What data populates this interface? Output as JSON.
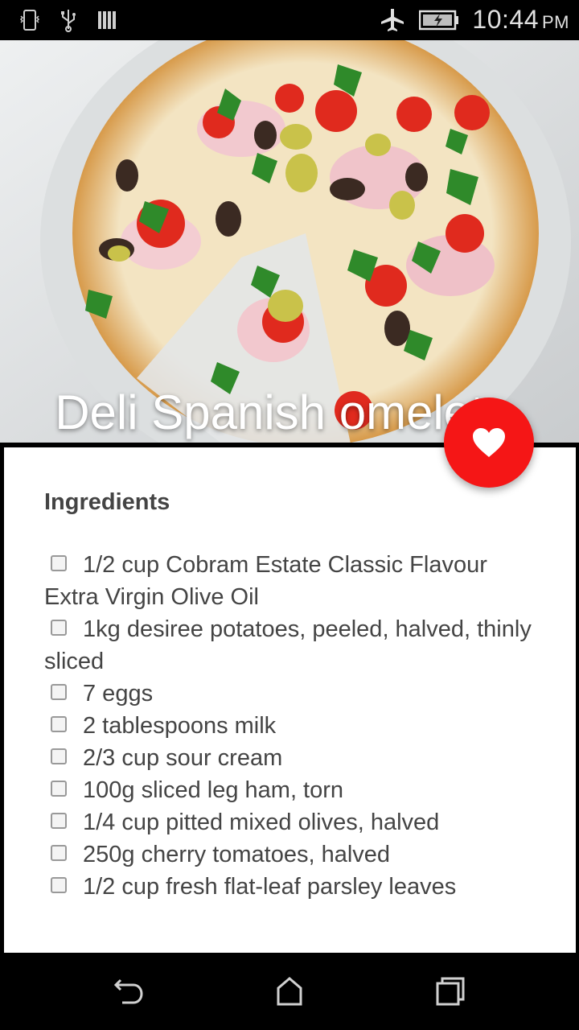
{
  "status_bar": {
    "time": "10:44",
    "ampm": "PM",
    "icons": [
      "phone-vibrate-icon",
      "usb-icon",
      "signal-bars-icon",
      "airplane-mode-icon",
      "battery-charging-icon"
    ]
  },
  "recipe": {
    "title": "Deli Spanish omelet...",
    "favorite_icon": "heart-icon",
    "favorite_color": "#f51616"
  },
  "ingredients": {
    "heading": "Ingredients",
    "items": [
      {
        "text": "1/2 cup Cobram Estate Classic Flavour Extra Virgin Olive Oil",
        "checked": false
      },
      {
        "text": "1kg desiree potatoes, peeled, halved, thinly sliced",
        "checked": false
      },
      {
        "text": "7 eggs",
        "checked": false
      },
      {
        "text": "2 tablespoons milk",
        "checked": false
      },
      {
        "text": "2/3 cup sour cream",
        "checked": false
      },
      {
        "text": "100g sliced leg ham, torn",
        "checked": false
      },
      {
        "text": "1/4 cup pitted mixed olives, halved",
        "checked": false
      },
      {
        "text": "250g cherry tomatoes, halved",
        "checked": false
      },
      {
        "text": "1/2 cup fresh flat-leaf parsley leaves",
        "checked": false
      }
    ]
  },
  "nav_bar": {
    "buttons": [
      "back-icon",
      "home-icon",
      "recent-apps-icon"
    ]
  }
}
